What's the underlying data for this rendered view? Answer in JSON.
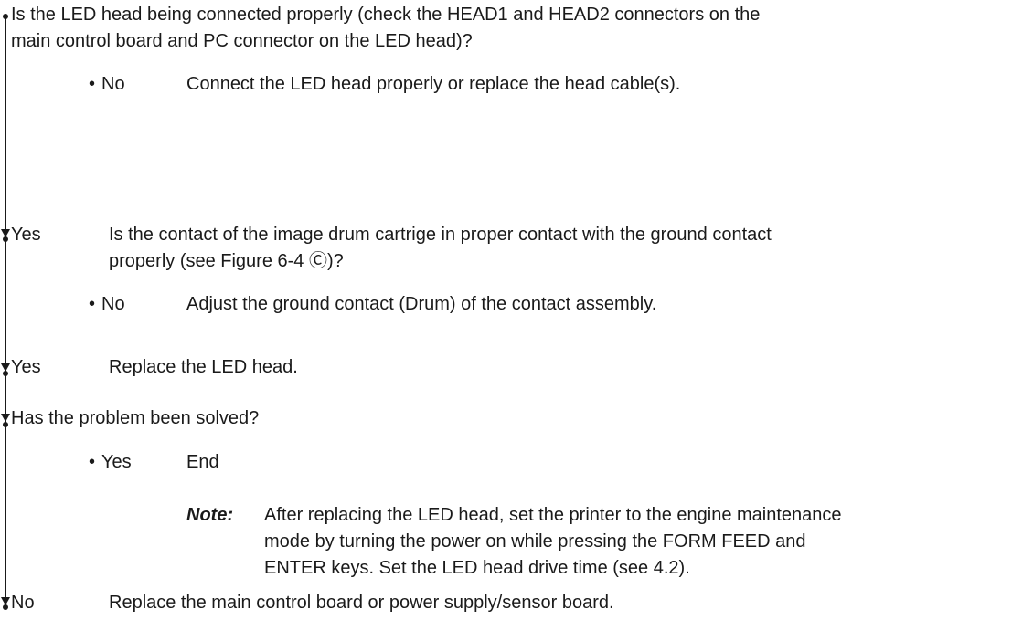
{
  "blocks": {
    "q1": {
      "line1": "Is the LED head being connected properly  (check the HEAD1 and HEAD2 connectors on the",
      "line2": "main control board and PC connector on the LED head)?"
    },
    "no1": {
      "bullet": "•",
      "answer": "No",
      "action": "Connect the LED head properly or replace the head cable(s)."
    },
    "yes1": {
      "answer": "Yes",
      "line1": "Is the contact of the image drum cartrige in proper contact with the ground contact",
      "line2": "properly  (see Figure 6-4 Ⓒ)?"
    },
    "no2": {
      "bullet": "•",
      "answer": "No",
      "action": "Adjust the ground contact (Drum) of the contact assembly."
    },
    "yes2": {
      "answer": "Yes",
      "action": "Replace the LED head."
    },
    "q2": {
      "text": "Has the problem been solved?"
    },
    "yes3": {
      "bullet": "•",
      "answer": "Yes",
      "action": "End"
    },
    "note": {
      "label": "Note:",
      "line1": "After replacing the LED head, set the printer to the engine maintenance",
      "line2": "mode by turning the power on while pressing the FORM FEED and",
      "line3": "ENTER keys.  Set the LED head drive time  (see 4.2)."
    },
    "no3": {
      "answer": "No",
      "action": "Replace the main control board or power supply/sensor board."
    }
  }
}
